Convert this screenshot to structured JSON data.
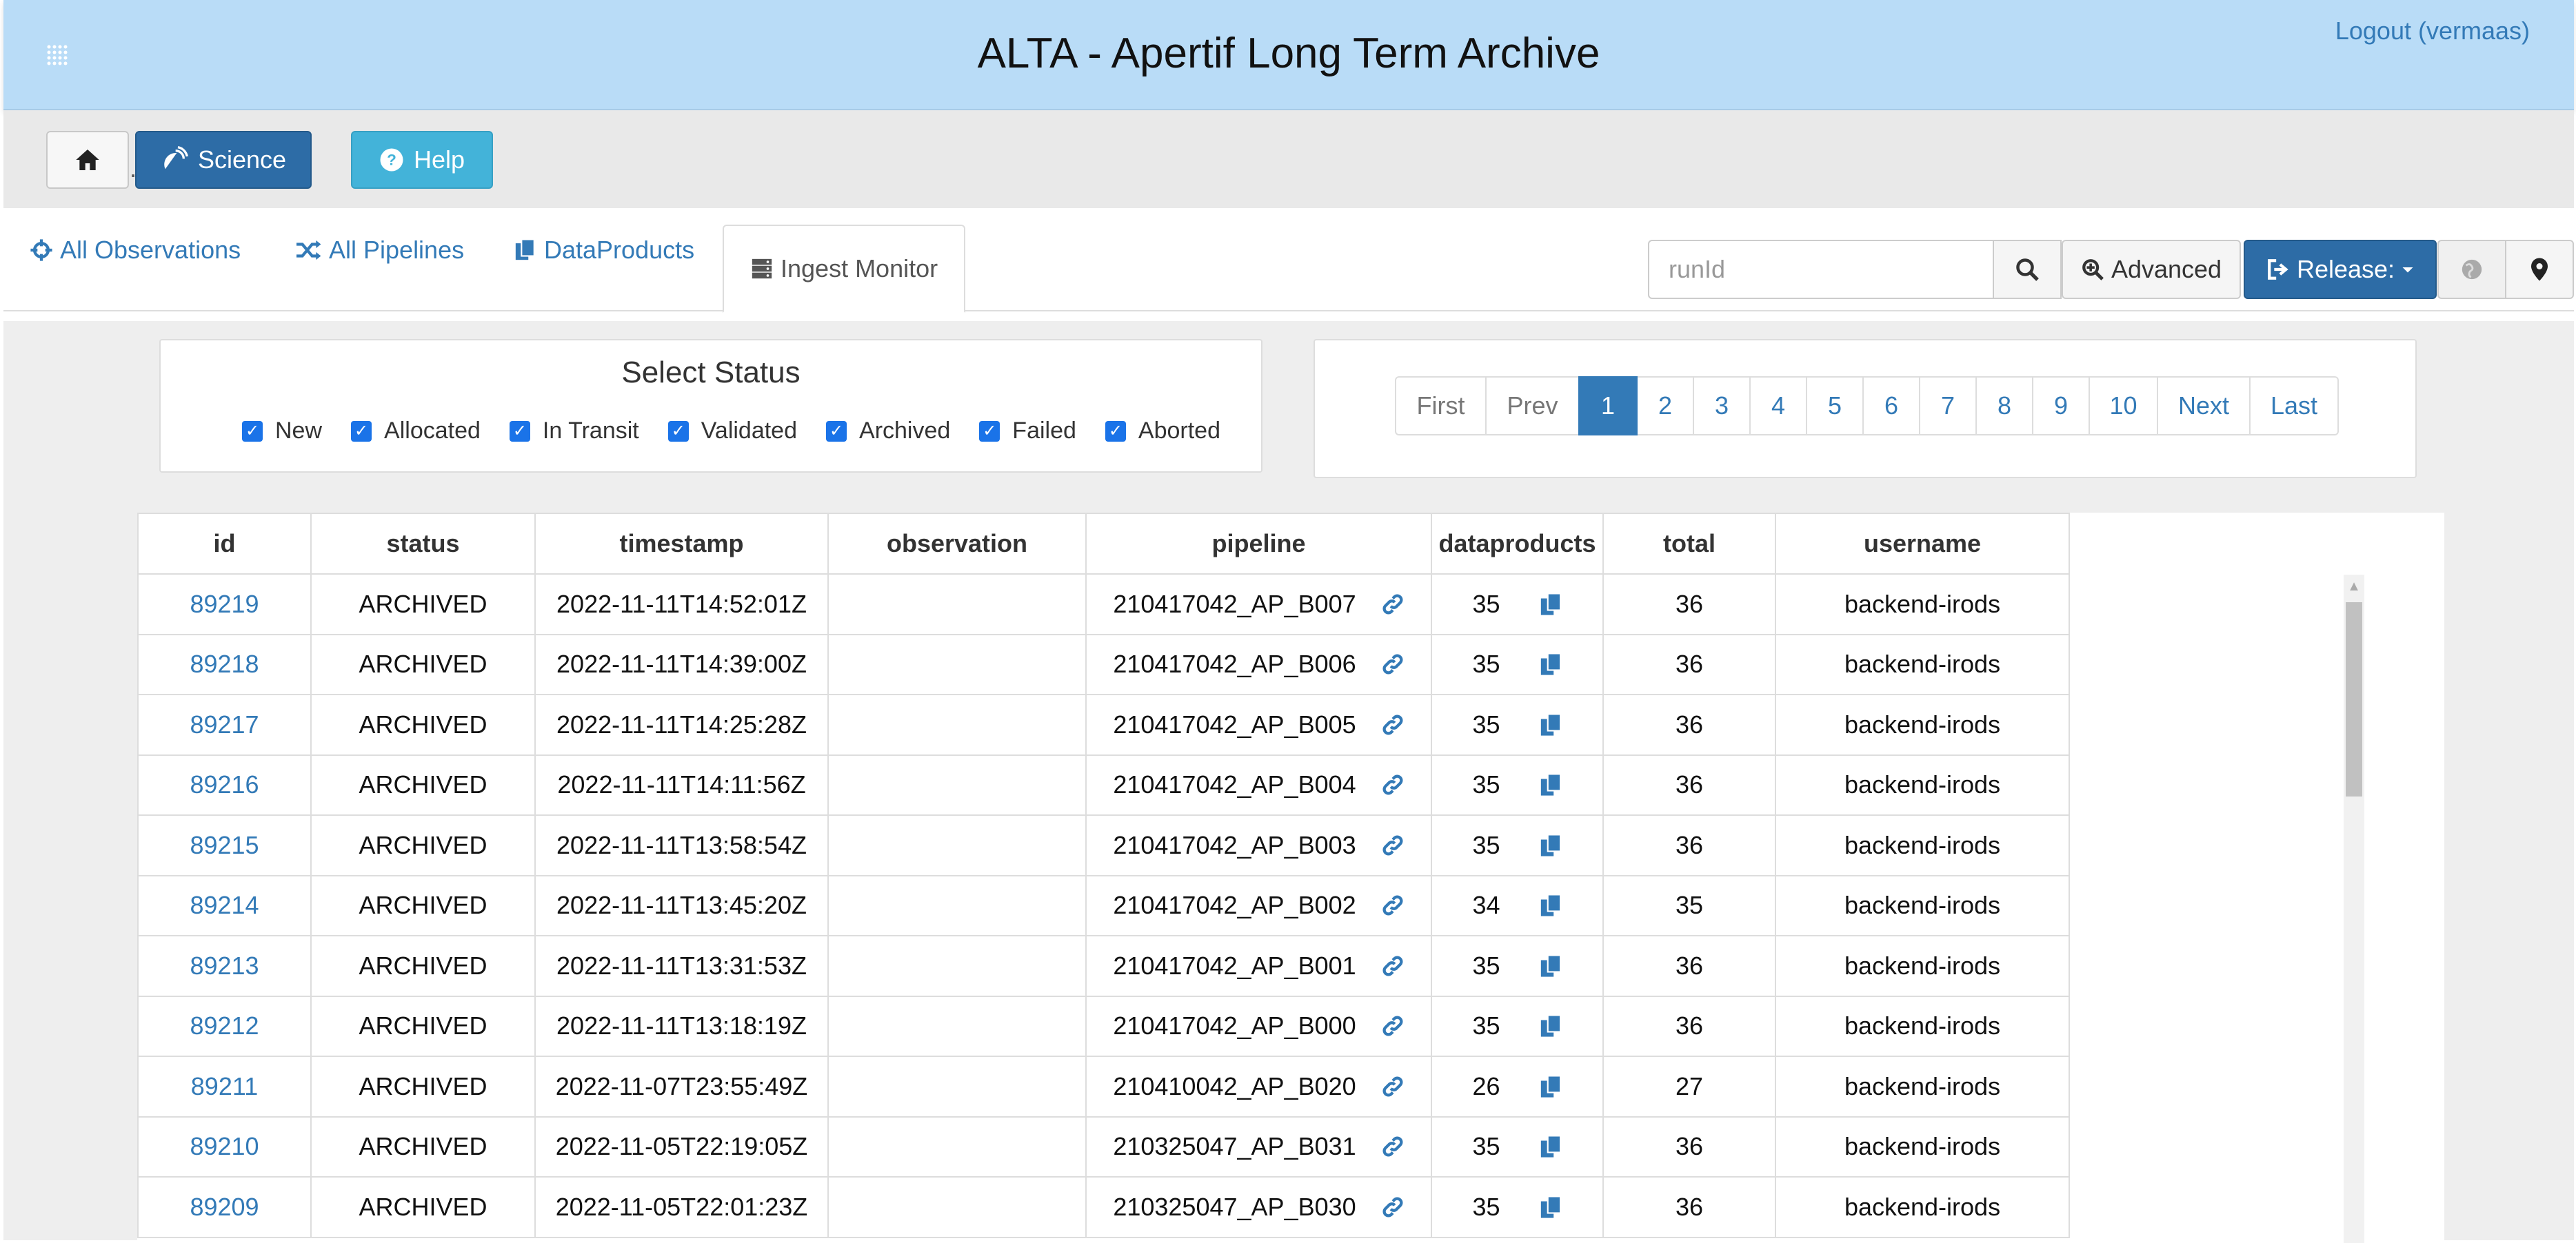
{
  "banner": {
    "title": "ALTA - Apertif Long Term Archive",
    "logout": "Logout (vermaas)"
  },
  "toolbar": {
    "home_icon": "home-icon",
    "science_label": "Science",
    "help_label": "Help",
    "separator": "."
  },
  "nav": {
    "tabs": [
      {
        "label": "All Observations",
        "icon": "crosshair-icon"
      },
      {
        "label": "All Pipelines",
        "icon": "shuffle-icon"
      },
      {
        "label": "DataProducts",
        "icon": "files-icon"
      },
      {
        "label": "Ingest Monitor",
        "icon": "server-icon"
      }
    ],
    "active_tab": "Ingest Monitor",
    "search": {
      "placeholder": "runId",
      "value": ""
    },
    "advanced_label": "Advanced",
    "release_label": "Release:"
  },
  "status_filter": {
    "title": "Select Status",
    "options": [
      {
        "label": "New",
        "checked": true
      },
      {
        "label": "Allocated",
        "checked": true
      },
      {
        "label": "In Transit",
        "checked": true
      },
      {
        "label": "Validated",
        "checked": true
      },
      {
        "label": "Archived",
        "checked": true
      },
      {
        "label": "Failed",
        "checked": true
      },
      {
        "label": "Aborted",
        "checked": true
      }
    ]
  },
  "pagination": {
    "items": [
      "First",
      "Prev",
      "1",
      "2",
      "3",
      "4",
      "5",
      "6",
      "7",
      "8",
      "9",
      "10",
      "Next",
      "Last"
    ],
    "active": "1"
  },
  "table": {
    "columns": [
      "id",
      "status",
      "timestamp",
      "observation",
      "pipeline",
      "dataproducts",
      "total",
      "username"
    ],
    "rows": [
      {
        "id": "89219",
        "status": "ARCHIVED",
        "timestamp": "2022-11-11T14:52:01Z",
        "observation": "",
        "pipeline": "210417042_AP_B007",
        "dataproducts": "35",
        "total": "36",
        "username": "backend-irods"
      },
      {
        "id": "89218",
        "status": "ARCHIVED",
        "timestamp": "2022-11-11T14:39:00Z",
        "observation": "",
        "pipeline": "210417042_AP_B006",
        "dataproducts": "35",
        "total": "36",
        "username": "backend-irods"
      },
      {
        "id": "89217",
        "status": "ARCHIVED",
        "timestamp": "2022-11-11T14:25:28Z",
        "observation": "",
        "pipeline": "210417042_AP_B005",
        "dataproducts": "35",
        "total": "36",
        "username": "backend-irods"
      },
      {
        "id": "89216",
        "status": "ARCHIVED",
        "timestamp": "2022-11-11T14:11:56Z",
        "observation": "",
        "pipeline": "210417042_AP_B004",
        "dataproducts": "35",
        "total": "36",
        "username": "backend-irods"
      },
      {
        "id": "89215",
        "status": "ARCHIVED",
        "timestamp": "2022-11-11T13:58:54Z",
        "observation": "",
        "pipeline": "210417042_AP_B003",
        "dataproducts": "35",
        "total": "36",
        "username": "backend-irods"
      },
      {
        "id": "89214",
        "status": "ARCHIVED",
        "timestamp": "2022-11-11T13:45:20Z",
        "observation": "",
        "pipeline": "210417042_AP_B002",
        "dataproducts": "34",
        "total": "35",
        "username": "backend-irods"
      },
      {
        "id": "89213",
        "status": "ARCHIVED",
        "timestamp": "2022-11-11T13:31:53Z",
        "observation": "",
        "pipeline": "210417042_AP_B001",
        "dataproducts": "35",
        "total": "36",
        "username": "backend-irods"
      },
      {
        "id": "89212",
        "status": "ARCHIVED",
        "timestamp": "2022-11-11T13:18:19Z",
        "observation": "",
        "pipeline": "210417042_AP_B000",
        "dataproducts": "35",
        "total": "36",
        "username": "backend-irods"
      },
      {
        "id": "89211",
        "status": "ARCHIVED",
        "timestamp": "2022-11-07T23:55:49Z",
        "observation": "",
        "pipeline": "210410042_AP_B020",
        "dataproducts": "26",
        "total": "27",
        "username": "backend-irods"
      },
      {
        "id": "89210",
        "status": "ARCHIVED",
        "timestamp": "2022-11-05T22:19:05Z",
        "observation": "",
        "pipeline": "210325047_AP_B031",
        "dataproducts": "35",
        "total": "36",
        "username": "backend-irods"
      },
      {
        "id": "89209",
        "status": "ARCHIVED",
        "timestamp": "2022-11-05T22:01:23Z",
        "observation": "",
        "pipeline": "210325047_AP_B030",
        "dataproducts": "35",
        "total": "36",
        "username": "backend-irods"
      }
    ]
  },
  "colors": {
    "banner": "#b9dcf7",
    "primary": "#2d6ca6",
    "info": "#43b3d9",
    "link": "#337ab7"
  }
}
